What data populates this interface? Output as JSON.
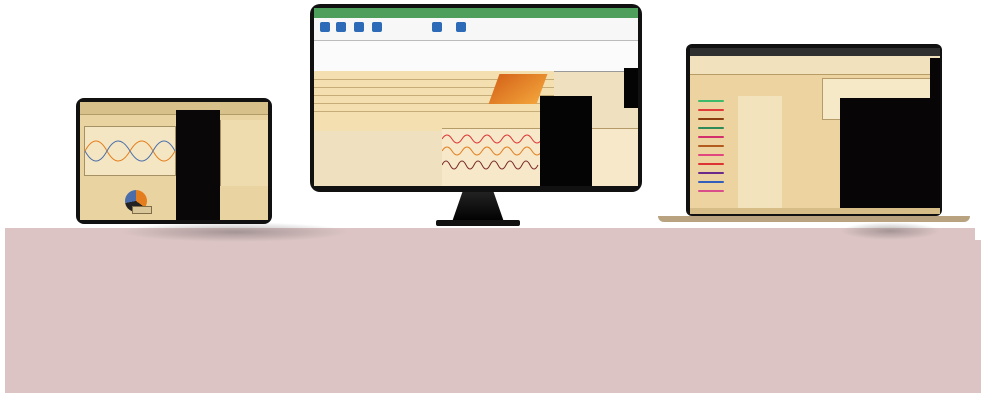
{
  "colors": {
    "floor": "#dcc4c4",
    "screen_bg": "#ecd3a0",
    "accent_green": "#4d9f5b",
    "accent_orange": "#e37d1d",
    "accent_blue": "#2d6bb8"
  },
  "laptop": {
    "bar_colors": [
      "#3dbb6b",
      "#e23a3a",
      "#8a3d0f",
      "#2e8b57",
      "#d22f6d",
      "#b35a1f",
      "#e0477f",
      "#d33",
      "#6a2b8b",
      "#345ebb",
      "#d84d8a"
    ]
  },
  "icons": [
    "ribbon-icon",
    "pie-icon",
    "wave-icon"
  ]
}
